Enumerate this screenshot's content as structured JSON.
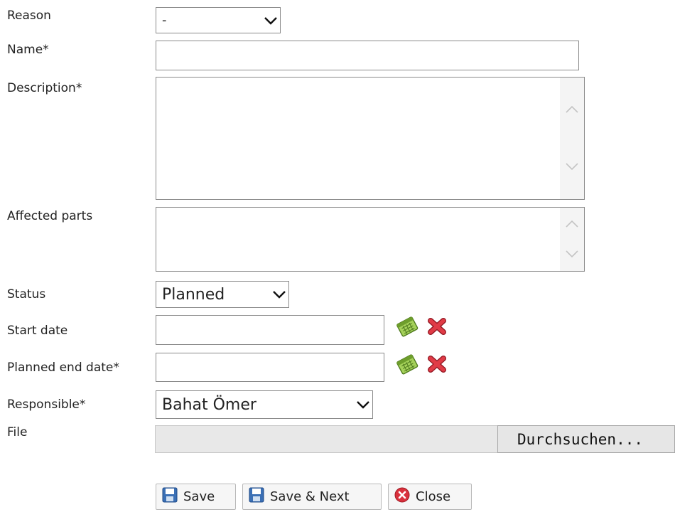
{
  "form": {
    "reason": {
      "label": "Reason",
      "value": "-"
    },
    "name": {
      "label": "Name*",
      "value": ""
    },
    "description": {
      "label": "Description*",
      "value": ""
    },
    "affected_parts": {
      "label": "Affected parts",
      "value": ""
    },
    "status": {
      "label": "Status",
      "value": "Planned"
    },
    "start_date": {
      "label": "Start date",
      "value": ""
    },
    "planned_end_date": {
      "label": "Planned end date*",
      "value": ""
    },
    "responsible": {
      "label": "Responsible*",
      "value": "Bahat Ömer"
    },
    "file": {
      "label": "File",
      "browse_label": "Durchsuchen..."
    }
  },
  "actions": {
    "save_label": "Save",
    "save_next_label": "Save & Next",
    "close_label": "Close"
  },
  "icons": {
    "calendar": "calendar-icon",
    "clear": "clear-date-icon",
    "save": "floppy-disk-icon",
    "close": "close-circle-icon"
  },
  "colors": {
    "border": "#8a8a8a",
    "clear_red": "#d9303c",
    "calendar_green": "#8fc63d",
    "floppy_blue": "#3a6fb5"
  }
}
